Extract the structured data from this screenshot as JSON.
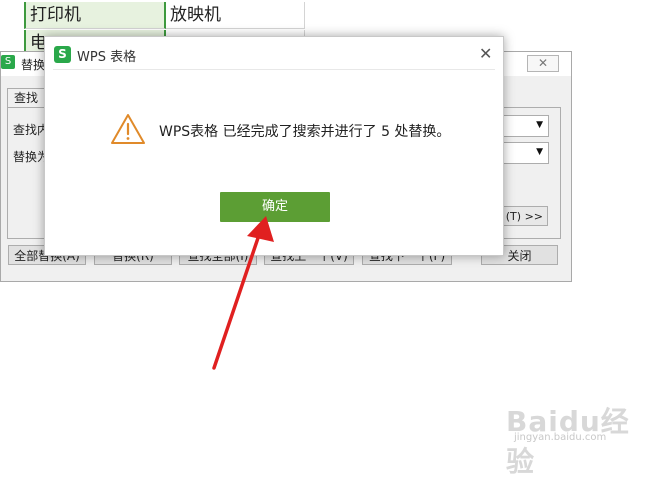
{
  "sheet": {
    "rows": [
      {
        "col_a": "打印机",
        "col_b": "放映机"
      },
      {
        "col_a": "电",
        "col_b": ""
      }
    ]
  },
  "replace_dialog": {
    "title": "替换",
    "logo": "S",
    "close": "✕",
    "tab_find": "查找",
    "find_label": "查找内",
    "replace_label": "替换为",
    "options_button": "(T) >>",
    "buttons": [
      "全部替换(A)",
      "替换(R)",
      "查找全部(I)",
      "查找上一个(V)",
      "查找下一个(F)",
      "关闭"
    ]
  },
  "message_box": {
    "logo": "S",
    "title": "WPS 表格",
    "close": "✕",
    "icon": "warning-triangle-icon",
    "message": "WPS表格 已经完成了搜索并进行了 5 处替换。",
    "ok_label": "确定"
  },
  "annotation": {
    "color": "#e02020"
  },
  "watermark": {
    "logo": "Baidu经验",
    "url": "jingyan.baidu.com"
  },
  "colors": {
    "accent_green": "#5c9e34",
    "wps_logo": "#2aa84a",
    "warning": "#e08a2a"
  }
}
